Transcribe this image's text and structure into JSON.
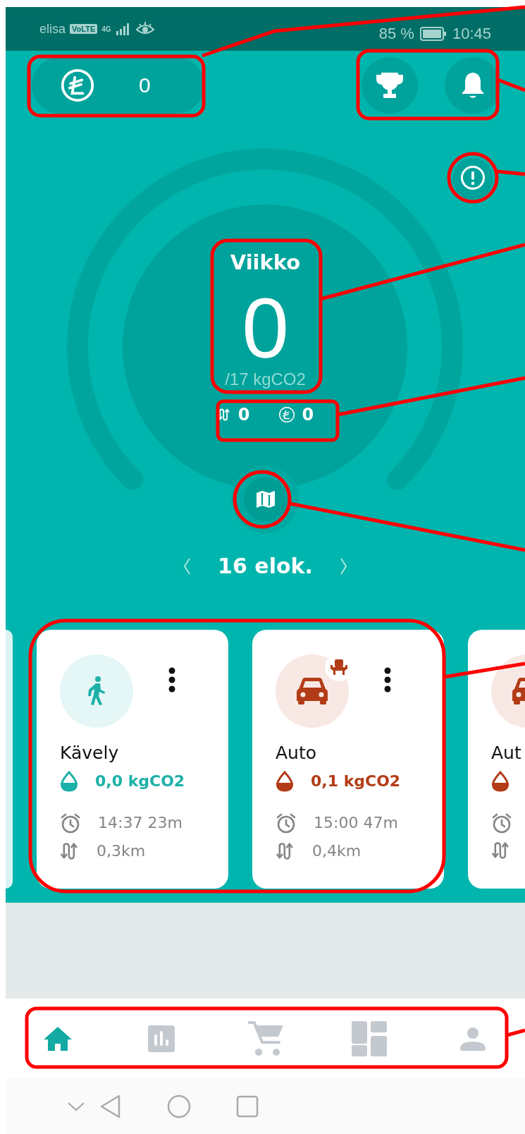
{
  "status_bar": {
    "carrier": "elisa",
    "network_badge": "VoLTE",
    "network_type": "4G",
    "battery_percent": "85 %",
    "time": "10:45"
  },
  "header": {
    "coins": "0"
  },
  "week": {
    "title": "Viikko",
    "value": "0",
    "target": "/17 kgCO2",
    "distance": "0",
    "coins": "0"
  },
  "date": {
    "label": "16 elok."
  },
  "trips": [
    {
      "kind": "walk",
      "title": "Kävely",
      "co2": "0,0 kgCO2",
      "time": "14:37 23m",
      "distance": "0,3km",
      "seat_badge": false
    },
    {
      "kind": "car",
      "title": "Auto",
      "co2": "0,1 kgCO2",
      "time": "15:00 47m",
      "distance": "0,4km",
      "seat_badge": true
    },
    {
      "kind": "car",
      "title": "Aut"
    }
  ],
  "bottom_nav": [
    {
      "selected": true
    },
    {
      "selected": false
    },
    {
      "selected": false
    },
    {
      "selected": false
    },
    {
      "selected": false
    }
  ]
}
